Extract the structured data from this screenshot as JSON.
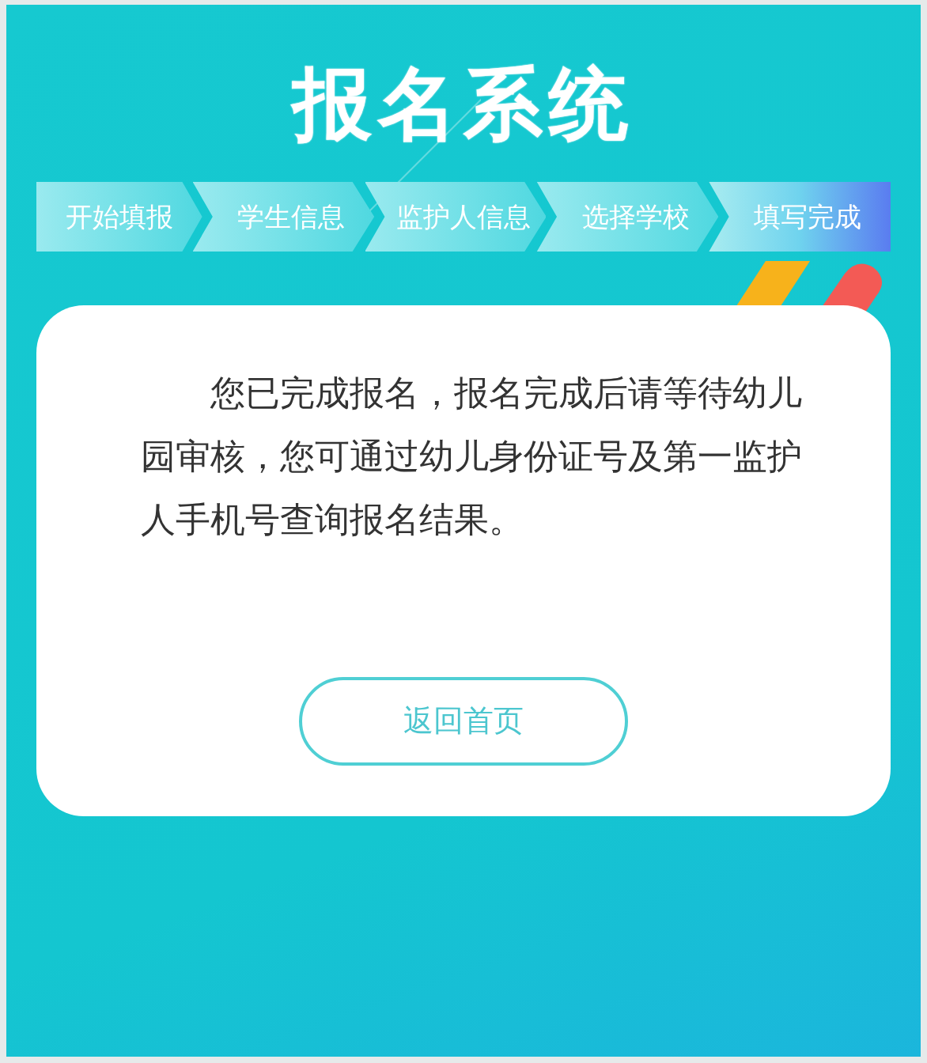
{
  "title": "报名系统",
  "steps": [
    {
      "label": "开始填报",
      "selected": false
    },
    {
      "label": "学生信息",
      "selected": false
    },
    {
      "label": "监护人信息",
      "selected": false
    },
    {
      "label": "选择学校",
      "selected": false
    },
    {
      "label": "填写完成",
      "selected": true
    }
  ],
  "message": "您已完成报名，报名完成后请等待幼儿园审核，您可通过幼儿身份证号及第一监护人手机号查询报名结果。",
  "button": "返回首页"
}
